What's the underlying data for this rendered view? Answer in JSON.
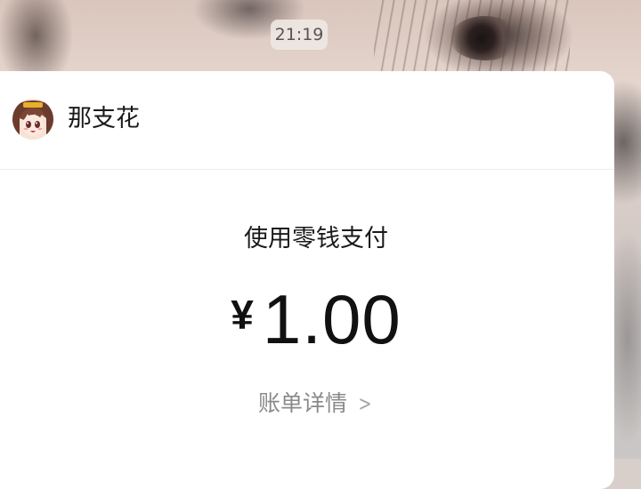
{
  "chat": {
    "timestamp": "21:19"
  },
  "transfer": {
    "payee_name": "那支花",
    "payee_avatar": "anime-girl-avatar",
    "payment_method": "使用零钱支付",
    "currency_symbol": "¥",
    "amount": "1.00",
    "details_link": "账单详情",
    "details_icon": "chevron-right-icon"
  }
}
